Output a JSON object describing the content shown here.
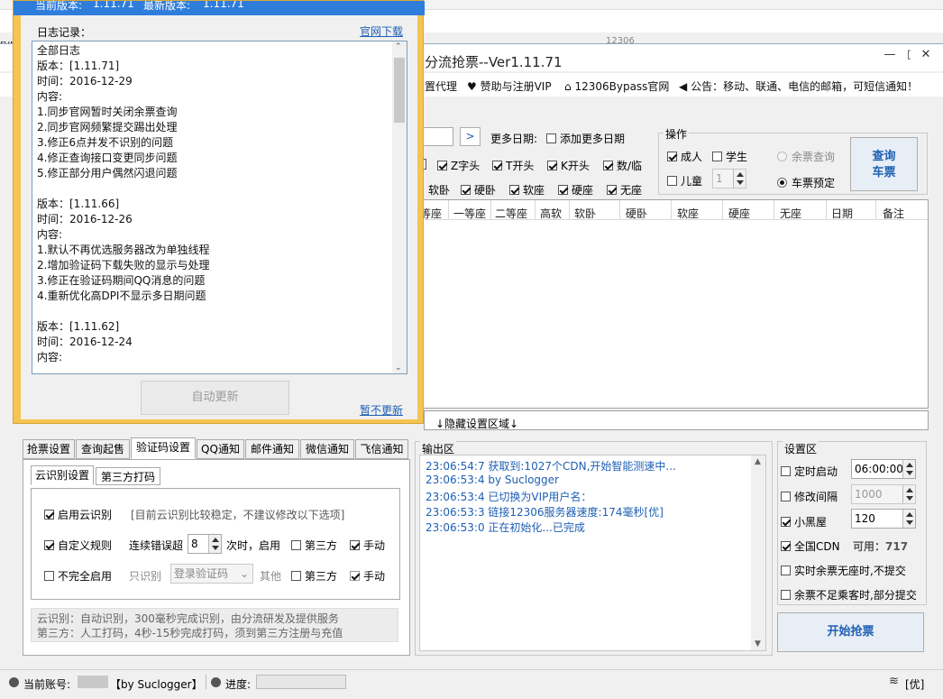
{
  "background_window": {
    "tab_fragment": "ryp",
    "mid_text": "12306"
  },
  "window": {
    "title": "分流抢票--Ver1.11.71",
    "minimize": "—",
    "maximize": "□",
    "close": "✕",
    "menu": {
      "proxy": "置代理",
      "sponsor": "赞助与注册VIP",
      "bypass_site": "12306Bypass官网",
      "notice": "公告：移动、联通、电信的邮箱，可短信通知！"
    }
  },
  "query": {
    "more_dates_label": "更多日期:",
    "add_more_dates": "添加更多日期",
    "go_arrow": ">",
    "train_types": [
      {
        "label": "Z字头",
        "checked": true
      },
      {
        "label": "T开头",
        "checked": true
      },
      {
        "label": "K开头",
        "checked": true
      },
      {
        "label": "数/临",
        "checked": true
      }
    ],
    "seat_filter": {
      "partial": "软卧"
    },
    "seats": [
      {
        "label": "硬卧",
        "checked": true
      },
      {
        "label": "软座",
        "checked": true
      },
      {
        "label": "硬座",
        "checked": true
      },
      {
        "label": "无座",
        "checked": true
      }
    ]
  },
  "ops": {
    "title": "操作",
    "adult": "成人",
    "student": "学生",
    "child": "儿童",
    "child_count": "1",
    "remain_query": "余票查询",
    "book": "车票预定",
    "query_button": [
      "查询",
      "车票"
    ]
  },
  "table": {
    "columns": [
      "等座",
      "一等座",
      "二等座",
      "高软",
      "软卧",
      "硬卧",
      "软座",
      "硬座",
      "无座",
      "日期",
      "备注"
    ]
  },
  "hidden_settings": "↓隐藏设置区域↓",
  "tabs": [
    "抢票设置",
    "查询起售",
    "验证码设置",
    "QQ通知",
    "邮件通知",
    "微信通知",
    "飞信通知"
  ],
  "subtabs": [
    "云识别设置",
    "第三方打码"
  ],
  "captcha": {
    "cloud_enable": "启用云识别",
    "cloud_note": "[目前云识别比较稳定，不建议修改以下选项]",
    "custom_rule": "自定义规则",
    "consecutive_errors": "连续错误超",
    "error_count": "8",
    "times_enable": "次时，启用",
    "third_party": "第三方",
    "manual": "手动",
    "incomplete_enable": "不完全启用",
    "only_recognize": "只识别",
    "login_captcha": "登录验证码",
    "other": "其他",
    "info": [
      "云识别：自动识别，300毫秒完成识别，由分流研发及提供服务",
      "第三方：人工打码，4秒-15秒完成打码，须到第三方注册与充值"
    ]
  },
  "output": {
    "title": "输出区",
    "lines": [
      "23:06:54:7  获取到:1027个CDN,开始智能测速中...",
      "23:06:53:4  by Suclogger",
      "23:06:53:4  已切换为VIP用户名：",
      "23:06:53:3  链接12306服务器速度:174毫秒[优]",
      "23:06:53:0  正在初始化...已完成"
    ]
  },
  "settings": {
    "title": "设置区",
    "timer_start": "定时启动",
    "timer_value": "06:00:00",
    "modify_interval": "修改间隔",
    "interval_value": "1000",
    "blackroom": "小黑屋",
    "blackroom_value": "120",
    "all_cdn": "全国CDN",
    "available_label": "可用：",
    "available_count": "717",
    "realtime_no_seat": "实时余票无座时,不提交",
    "insufficient": "余票不足乘客时,部分提交",
    "start_button": "开始抢票"
  },
  "status": {
    "account_label": "当前账号:",
    "by": "【by Suclogger】",
    "progress_label": "进度:",
    "quality": "[优]"
  },
  "dialog": {
    "current_version_label": "当前版本:",
    "current_version": "1.11.71",
    "latest_version_label": "最新版本:",
    "latest_version": "1.11.71",
    "log_label": "日志记录：",
    "download_link": "官网下载",
    "log_text": "全部日志\n版本：[1.11.71]\n时间：2016-12-29\n内容:\n1.同步官网暂时关闭余票查询\n2.同步官网频繁提交踢出处理\n3.修正6点并发不识别的问题\n4.修正查询接口变更同步问题\n5.修正部分用户偶然闪退问题\n\n版本：[1.11.66]\n时间：2016-12-26\n内容:\n1.默认不再优选服务器改为单独线程\n2.增加验证码下载失败的显示与处理\n3.修正在验证码期间QQ消息的问题\n4.重新优化高DPI不显示多日期问题\n\n版本：[1.11.62]\n时间：2016-12-24\n内容:",
    "auto_update": "自动更新",
    "no_update": "暂不更新"
  }
}
